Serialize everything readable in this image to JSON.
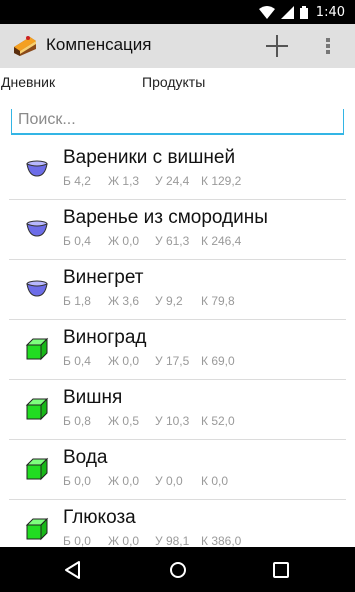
{
  "status_bar": {
    "time": "1:40"
  },
  "action_bar": {
    "title": "Компенсация"
  },
  "tabs": [
    {
      "label": "Дневник"
    },
    {
      "label": "Продукты"
    }
  ],
  "search": {
    "placeholder": "Поиск..."
  },
  "products": [
    {
      "name": "Вареники с вишней",
      "icon": "dish-bowl-icon",
      "protein": "Б 4,2",
      "fat": "Ж 1,3",
      "carbs": "У 24,4",
      "kcal": "К 129,2"
    },
    {
      "name": "Варенье из смородины",
      "icon": "dish-bowl-icon",
      "protein": "Б 0,4",
      "fat": "Ж 0,0",
      "carbs": "У 61,3",
      "kcal": "К 246,4"
    },
    {
      "name": "Винегрет",
      "icon": "dish-bowl-icon",
      "protein": "Б 1,8",
      "fat": "Ж 3,6",
      "carbs": "У 9,2",
      "kcal": "К 79,8"
    },
    {
      "name": "Виноград",
      "icon": "food-cube-icon",
      "protein": "Б 0,4",
      "fat": "Ж 0,0",
      "carbs": "У 17,5",
      "kcal": "К 69,0"
    },
    {
      "name": "Вишня",
      "icon": "food-cube-icon",
      "protein": "Б 0,8",
      "fat": "Ж 0,5",
      "carbs": "У 10,3",
      "kcal": "К 52,0"
    },
    {
      "name": "Вода",
      "icon": "food-cube-icon",
      "protein": "Б 0,0",
      "fat": "Ж 0,0",
      "carbs": "У 0,0",
      "kcal": "К 0,0"
    },
    {
      "name": "Глюкоза",
      "icon": "food-cube-icon",
      "protein": "Б 0,0",
      "fat": "Ж 0,0",
      "carbs": "У 98,1",
      "kcal": "К 386,0"
    }
  ],
  "colors": {
    "accent": "#33b5e5",
    "cube": "#22dd22",
    "bowl": "#7777ee",
    "action_bar": "#e0e0e0"
  }
}
